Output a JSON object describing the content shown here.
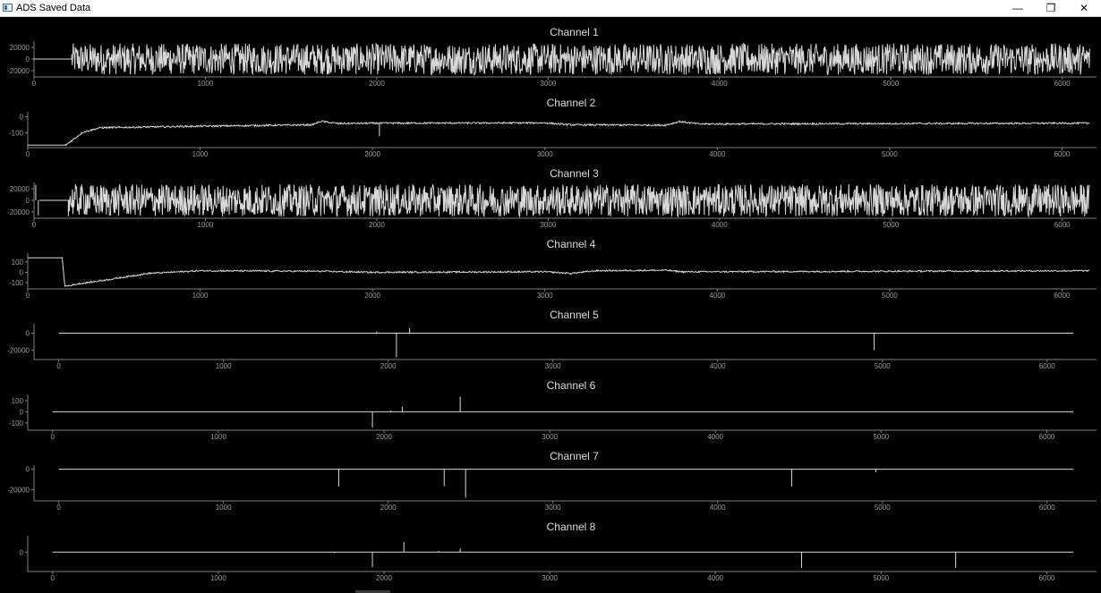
{
  "window": {
    "title": "ADS Saved Data",
    "minimize_glyph": "—",
    "maximize_glyph": "❐",
    "close_glyph": "✕",
    "icon": "app-window-icon"
  },
  "chart_data": [
    {
      "type": "line",
      "title": "Channel 1",
      "xlabel": "",
      "ylabel": "",
      "xlim": [
        0,
        6200
      ],
      "ylim": [
        -31000,
        31000
      ],
      "x_ticks": [
        0,
        1000,
        2000,
        3000,
        4000,
        5000,
        6000
      ],
      "y_ticks": [
        20000,
        0,
        -20000
      ],
      "grid": false,
      "signal": {
        "kind": "noise",
        "baseline": 0,
        "flat_until": 220,
        "flat_value": 0,
        "amplitude": 27000
      },
      "spikes": []
    },
    {
      "type": "line",
      "title": "Channel 2",
      "xlabel": "",
      "ylabel": "",
      "xlim": [
        0,
        6200
      ],
      "ylim": [
        -190,
        30
      ],
      "x_ticks": [
        0,
        1000,
        2000,
        3000,
        4000,
        5000,
        6000
      ],
      "y_ticks": [
        0,
        -100
      ],
      "grid": false,
      "signal": {
        "kind": "drift",
        "flat_until": 220,
        "flat_value": -175,
        "level_points": [
          [
            220,
            -175
          ],
          [
            320,
            -95
          ],
          [
            420,
            -68
          ],
          [
            900,
            -60
          ],
          [
            1650,
            -50
          ],
          [
            1700,
            -28
          ],
          [
            1800,
            -42
          ],
          [
            2000,
            -40
          ],
          [
            3000,
            -38
          ],
          [
            3150,
            -50
          ],
          [
            3700,
            -52
          ],
          [
            3780,
            -30
          ],
          [
            3900,
            -45
          ],
          [
            6160,
            -40
          ]
        ],
        "amplitude": 5
      },
      "spikes": [
        [
          2040,
          -120
        ]
      ]
    },
    {
      "type": "line",
      "title": "Channel 3",
      "xlabel": "",
      "ylabel": "",
      "xlim": [
        0,
        6200
      ],
      "ylim": [
        -31000,
        31000
      ],
      "x_ticks": [
        0,
        1000,
        2000,
        3000,
        4000,
        5000,
        6000
      ],
      "y_ticks": [
        20000,
        0,
        -20000
      ],
      "grid": false,
      "signal": {
        "kind": "noise",
        "baseline": 0,
        "flat_until": 200,
        "flat_value": 0,
        "amplitude": 28000
      },
      "spikes": [
        [
          10,
          27000
        ],
        [
          25,
          -26000
        ]
      ]
    },
    {
      "type": "line",
      "title": "Channel 4",
      "xlabel": "",
      "ylabel": "",
      "xlim": [
        0,
        6200
      ],
      "ylim": [
        -160,
        185
      ],
      "x_ticks": [
        0,
        1000,
        2000,
        3000,
        4000,
        5000,
        6000
      ],
      "y_ticks": [
        100,
        0,
        -100
      ],
      "grid": false,
      "signal": {
        "kind": "drift",
        "flat_until": 200,
        "flat_value": 140,
        "level_points": [
          [
            0,
            140
          ],
          [
            200,
            140
          ],
          [
            215,
            -135
          ],
          [
            300,
            -110
          ],
          [
            450,
            -75
          ],
          [
            700,
            -10
          ],
          [
            1000,
            15
          ],
          [
            1700,
            10
          ],
          [
            2000,
            0
          ],
          [
            3000,
            5
          ],
          [
            3150,
            -10
          ],
          [
            3300,
            15
          ],
          [
            3700,
            20
          ],
          [
            3800,
            5
          ],
          [
            6160,
            15
          ]
        ],
        "amplitude": 7
      },
      "spikes": [
        [
          3150,
          -25
        ]
      ]
    },
    {
      "type": "line",
      "title": "Channel 5",
      "xlabel": "",
      "ylabel": "",
      "xlim": [
        -150,
        6300
      ],
      "ylim": [
        -31000,
        11000
      ],
      "x_ticks": [
        0,
        1000,
        2000,
        3000,
        4000,
        5000,
        6000
      ],
      "y_ticks": [
        0,
        -20000
      ],
      "grid": false,
      "signal": {
        "kind": "flat",
        "value": 0
      },
      "spikes": [
        [
          1930,
          2000
        ],
        [
          2050,
          -28000
        ],
        [
          2130,
          6000
        ],
        [
          4950,
          -20000
        ]
      ]
    },
    {
      "type": "line",
      "title": "Channel 6",
      "xlabel": "",
      "ylabel": "",
      "xlim": [
        -150,
        6300
      ],
      "ylim": [
        -165,
        155
      ],
      "x_ticks": [
        0,
        1000,
        2000,
        3000,
        4000,
        5000,
        6000
      ],
      "y_ticks": [
        100,
        0,
        -100
      ],
      "grid": false,
      "signal": {
        "kind": "flat",
        "value": 0
      },
      "spikes": [
        [
          1930,
          -140
        ],
        [
          2040,
          10
        ],
        [
          2110,
          45
        ],
        [
          2460,
          135
        ],
        [
          4950,
          -5
        ]
      ]
    },
    {
      "type": "line",
      "title": "Channel 7",
      "xlabel": "",
      "ylabel": "",
      "xlim": [
        -150,
        6300
      ],
      "ylim": [
        -31000,
        4000
      ],
      "x_ticks": [
        0,
        1000,
        2000,
        3000,
        4000,
        5000,
        6000
      ],
      "y_ticks": [
        0,
        -20000
      ],
      "grid": false,
      "signal": {
        "kind": "flat",
        "value": 0
      },
      "spikes": [
        [
          1700,
          -17000
        ],
        [
          2340,
          -16500
        ],
        [
          2470,
          -28000
        ],
        [
          4450,
          -17000
        ],
        [
          4960,
          -3000
        ]
      ]
    },
    {
      "type": "line",
      "title": "Channel 8",
      "xlabel": "",
      "ylabel": "",
      "xlim": [
        -150,
        6300
      ],
      "ylim": [
        -160,
        135
      ],
      "x_ticks": [
        0,
        1000,
        2000,
        3000,
        4000,
        5000,
        6000
      ],
      "y_ticks": [
        0
      ],
      "grid": false,
      "signal": {
        "kind": "flat",
        "value": 0
      },
      "spikes": [
        [
          1700,
          -8
        ],
        [
          1930,
          -125
        ],
        [
          2120,
          85
        ],
        [
          2330,
          10
        ],
        [
          2460,
          30
        ],
        [
          4520,
          -130
        ],
        [
          5450,
          -130
        ]
      ]
    }
  ]
}
